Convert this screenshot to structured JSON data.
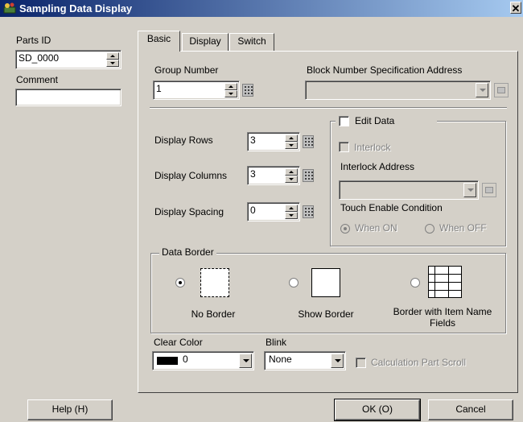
{
  "window": {
    "title": "Sampling Data Display",
    "close_glyph": "✕"
  },
  "left": {
    "parts_id_label": "Parts ID",
    "parts_id_value": "SD_0000",
    "comment_label": "Comment",
    "comment_value": ""
  },
  "tabs": [
    {
      "label": "Basic",
      "active": true
    },
    {
      "label": "Display",
      "active": false
    },
    {
      "label": "Switch",
      "active": false
    }
  ],
  "basic": {
    "group_number_label": "Group Number",
    "group_number_value": "1",
    "block_address_label": "Block Number Specification Address",
    "block_address_value": "",
    "display_rows_label": "Display Rows",
    "display_rows_value": "3",
    "display_columns_label": "Display Columns",
    "display_columns_value": "3",
    "display_spacing_label": "Display Spacing",
    "display_spacing_value": "0"
  },
  "edit_data": {
    "label": "Edit Data",
    "checked": false,
    "interlock_label": "Interlock",
    "interlock_address_label": "Interlock Address",
    "interlock_address_value": "",
    "touch_condition_label": "Touch Enable Condition",
    "when_on_label": "When ON",
    "when_off_label": "When OFF",
    "selected": "when_on"
  },
  "data_border": {
    "group_label": "Data Border",
    "options": [
      {
        "label": "No Border",
        "selected": true
      },
      {
        "label": "Show Border",
        "selected": false
      },
      {
        "label": "Border with Item Name Fields",
        "selected": false
      }
    ]
  },
  "bottom": {
    "clear_color_label": "Clear Color",
    "clear_color_value": "0",
    "clear_color_swatch": "#000000",
    "blink_label": "Blink",
    "blink_value": "None",
    "calc_scroll_label": "Calculation Part Scroll"
  },
  "buttons": {
    "help": "Help (H)",
    "ok": "OK (O)",
    "cancel": "Cancel"
  },
  "colors": {
    "dialog_face": "#d4d0c8",
    "title_start": "#0a246a",
    "title_end": "#a6caf0"
  }
}
